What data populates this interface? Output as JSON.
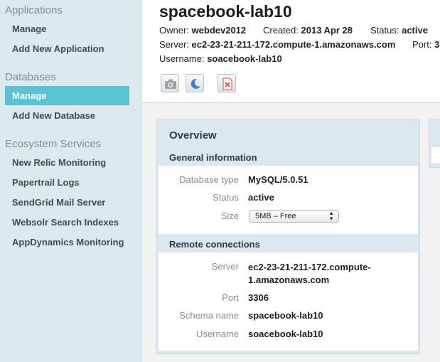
{
  "sidebar": {
    "sections": [
      {
        "title": "Applications",
        "items": [
          "Manage",
          "Add New Application"
        ]
      },
      {
        "title": "Databases",
        "items": [
          "Manage",
          "Add New Database"
        ],
        "active": "Manage"
      },
      {
        "title": "Ecosystem Services",
        "items": [
          "New Relic Monitoring",
          "Papertrail Logs",
          "SendGrid Mail Server",
          "Websolr Search Indexes",
          "AppDynamics Monitoring"
        ]
      }
    ]
  },
  "header": {
    "title": "spacebook-lab10",
    "owner_label": "Owner:",
    "owner": "webdev2012",
    "created_label": "Created:",
    "created": "2013 Apr 28",
    "status_label": "Status:",
    "status": "active",
    "server_label": "Server:",
    "server": "ec2-23-21-211-172.compute-1.amazonaws.com",
    "port_label": "Port:",
    "port": "3",
    "username_label": "Username:",
    "username": "soacebook-lab10",
    "actions": [
      "camera-icon",
      "sleep-icon",
      "delete-icon"
    ]
  },
  "overview": {
    "title": "Overview",
    "general": {
      "heading": "General information",
      "db_type_label": "Database type",
      "db_type": "MySQL/5.0.51",
      "status_label": "Status",
      "status": "active",
      "size_label": "Size",
      "size": "5MB – Free"
    },
    "remote": {
      "heading": "Remote connections",
      "server_label": "Server",
      "server_line1": "ec2-23-21-211-172.compute-",
      "server_line2": "1.amazonaws.com",
      "port_label": "Port",
      "port": "3306",
      "schema_label": "Schema name",
      "schema": "spacebook-lab10",
      "username_label": "Username",
      "username": "soacebook-lab10"
    }
  },
  "colors": {
    "sidebar_bg": "#dce9ef",
    "active_item": "#5bc3d6",
    "panel_bg": "#dbe8ee"
  }
}
